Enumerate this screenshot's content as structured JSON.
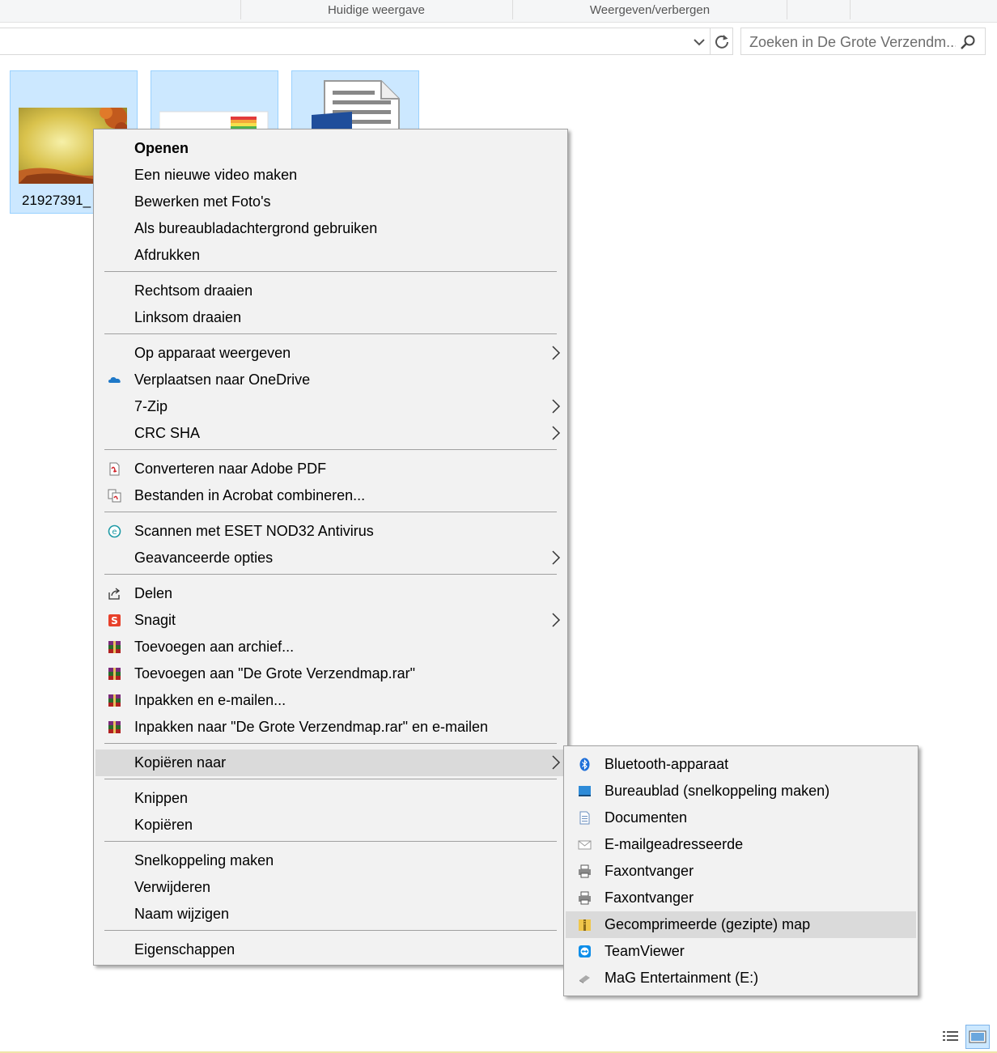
{
  "ribbon": {
    "groups": [
      "Huidige weergave",
      "Weergeven/verbergen"
    ]
  },
  "search": {
    "placeholder": "Zoeken in De Grote Verzendm..."
  },
  "files": [
    {
      "name": "21927391_"
    }
  ],
  "context_menu": {
    "items": [
      {
        "label": "Openen",
        "bold": true
      },
      {
        "label": "Een nieuwe video maken"
      },
      {
        "label": "Bewerken met Foto's"
      },
      {
        "label": "Als bureaubladachtergrond gebruiken"
      },
      {
        "label": "Afdrukken"
      },
      {
        "label": "Rechtsom draaien"
      },
      {
        "label": "Linksom draaien"
      },
      {
        "label": "Op apparaat weergeven",
        "submenu": true
      },
      {
        "label": "Verplaatsen naar OneDrive",
        "icon": "onedrive-icon"
      },
      {
        "label": "7-Zip",
        "submenu": true
      },
      {
        "label": "CRC SHA",
        "submenu": true
      },
      {
        "label": "Converteren naar Adobe PDF",
        "icon": "adobe-pdf-icon"
      },
      {
        "label": "Bestanden in Acrobat combineren...",
        "icon": "acrobat-combine-icon"
      },
      {
        "label": "Scannen met ESET NOD32 Antivirus",
        "icon": "eset-icon"
      },
      {
        "label": "Geavanceerde opties",
        "submenu": true
      },
      {
        "label": "Delen",
        "icon": "share-icon"
      },
      {
        "label": "Snagit",
        "icon": "snagit-icon",
        "submenu": true
      },
      {
        "label": "Toevoegen aan archief...",
        "icon": "winrar-icon"
      },
      {
        "label": "Toevoegen aan \"De Grote Verzendmap.rar\"",
        "icon": "winrar-icon"
      },
      {
        "label": "Inpakken en e-mailen...",
        "icon": "winrar-icon"
      },
      {
        "label": "Inpakken naar \"De Grote Verzendmap.rar\" en e-mailen",
        "icon": "winrar-icon"
      },
      {
        "label": "Kopiëren naar",
        "submenu": true,
        "highlighted": true
      },
      {
        "label": "Knippen"
      },
      {
        "label": "Kopiëren"
      },
      {
        "label": "Snelkoppeling maken"
      },
      {
        "label": "Verwijderen"
      },
      {
        "label": "Naam wijzigen"
      },
      {
        "label": "Eigenschappen"
      }
    ]
  },
  "send_to_menu": {
    "items": [
      {
        "label": "Bluetooth-apparaat",
        "icon": "bluetooth-icon"
      },
      {
        "label": "Bureaublad (snelkoppeling maken)",
        "icon": "desktop-icon"
      },
      {
        "label": "Documenten",
        "icon": "documents-icon"
      },
      {
        "label": "E-mailgeadresseerde",
        "icon": "mail-icon"
      },
      {
        "label": "Faxontvanger",
        "icon": "fax-icon"
      },
      {
        "label": "Faxontvanger",
        "icon": "fax-icon"
      },
      {
        "label": "Gecomprimeerde (gezipte) map",
        "icon": "zip-folder-icon",
        "highlighted": true
      },
      {
        "label": "TeamViewer",
        "icon": "teamviewer-icon"
      },
      {
        "label": "MaG Entertainment (E:)",
        "icon": "drive-icon"
      }
    ]
  },
  "colors": {
    "selection": "#cce8ff",
    "menu_bg": "#f2f2f2",
    "menu_highlight": "#dadada"
  }
}
